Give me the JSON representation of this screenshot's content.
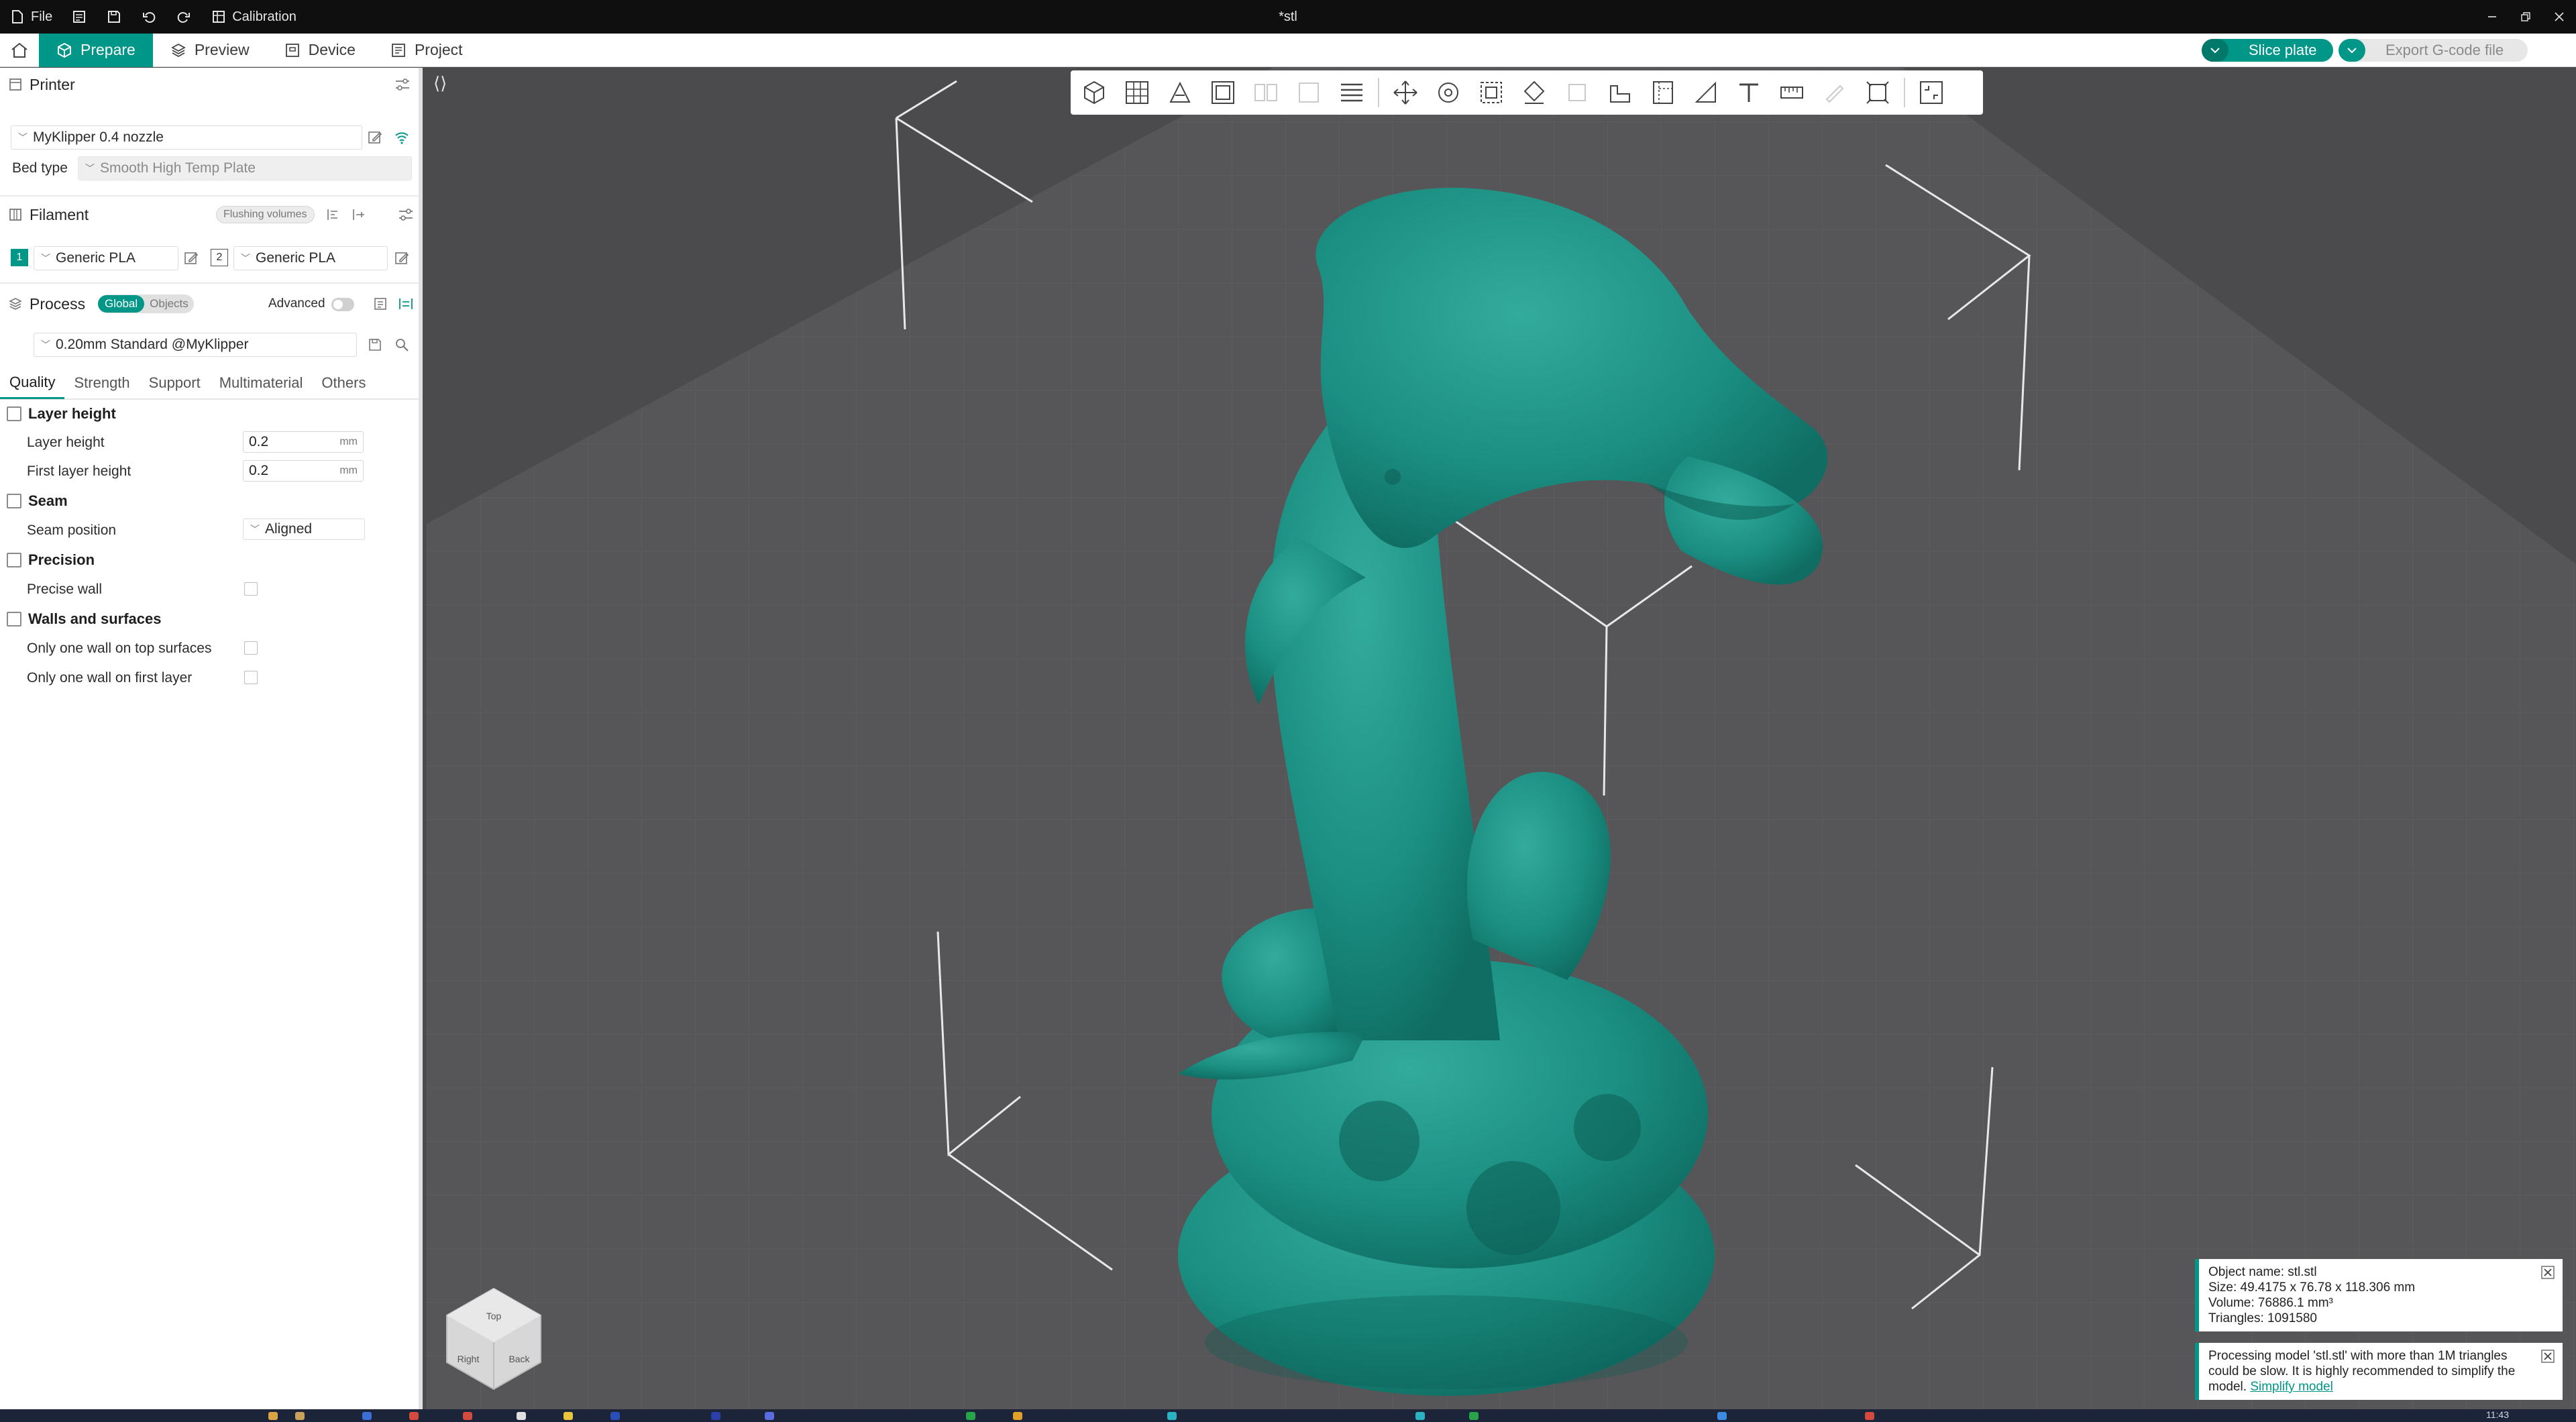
{
  "titlebar": {
    "file_label": "File",
    "calibration_label": "Calibration",
    "doc_title": "*stl"
  },
  "mainbar": {
    "tabs": [
      {
        "label": "Prepare",
        "icon": "cube-icon",
        "active": true
      },
      {
        "label": "Preview",
        "icon": "layers-icon",
        "active": false
      },
      {
        "label": "Device",
        "icon": "device-icon",
        "active": false
      },
      {
        "label": "Project",
        "icon": "project-icon",
        "active": false
      }
    ],
    "slice_label": "Slice plate",
    "export_label": "Export G-code file"
  },
  "sidebar": {
    "printer": {
      "title": "Printer",
      "preset": "MyKlipper 0.4 nozzle",
      "bed_type_label": "Bed type",
      "bed_type_value": "Smooth High Temp Plate"
    },
    "filament": {
      "title": "Filament",
      "flushing_label": "Flushing volumes",
      "slots": [
        {
          "index": "1",
          "name": "Generic PLA",
          "color": "#009688"
        },
        {
          "index": "2",
          "name": "Generic PLA",
          "color": "#ffffff"
        }
      ]
    },
    "process": {
      "title": "Process",
      "global_label": "Global",
      "objects_label": "Objects",
      "advanced_label": "Advanced",
      "preset": "0.20mm Standard @MyKlipper"
    },
    "tabs": [
      "Quality",
      "Strength",
      "Support",
      "Multimaterial",
      "Others"
    ],
    "groups": {
      "layer_height": {
        "title": "Layer height",
        "layer_height_label": "Layer height",
        "layer_height_value": "0.2",
        "first_layer_label": "First layer height",
        "first_layer_value": "0.2",
        "unit": "mm"
      },
      "seam": {
        "title": "Seam",
        "position_label": "Seam position",
        "position_value": "Aligned"
      },
      "precision": {
        "title": "Precision",
        "precise_wall_label": "Precise wall"
      },
      "walls": {
        "title": "Walls and surfaces",
        "one_wall_top_label": "Only one wall on top surfaces",
        "one_wall_first_label": "Only one wall on first layer"
      }
    }
  },
  "viewport": {
    "cube_labels": {
      "top": "Top",
      "left": "Right",
      "right": "Back"
    }
  },
  "notifications": {
    "object_info": {
      "name": "Object name: stl.stl",
      "size": "Size: 49.4175 x 76.78 x 118.306 mm",
      "volume": "Volume: 76886.1 mm³",
      "triangles": "Triangles: 1091580"
    },
    "processing": {
      "message": "Processing model 'stl.stl' with more than 1M triangles could be slow. It is highly recommended to simplify the model.",
      "link": "Simplify model"
    }
  },
  "taskbar": {
    "time": "11:43"
  },
  "colors": {
    "accent": "#009688",
    "model": "#1b8f82",
    "viewport_bg": "#4b4b4d",
    "bed": "#5a5a5c"
  }
}
